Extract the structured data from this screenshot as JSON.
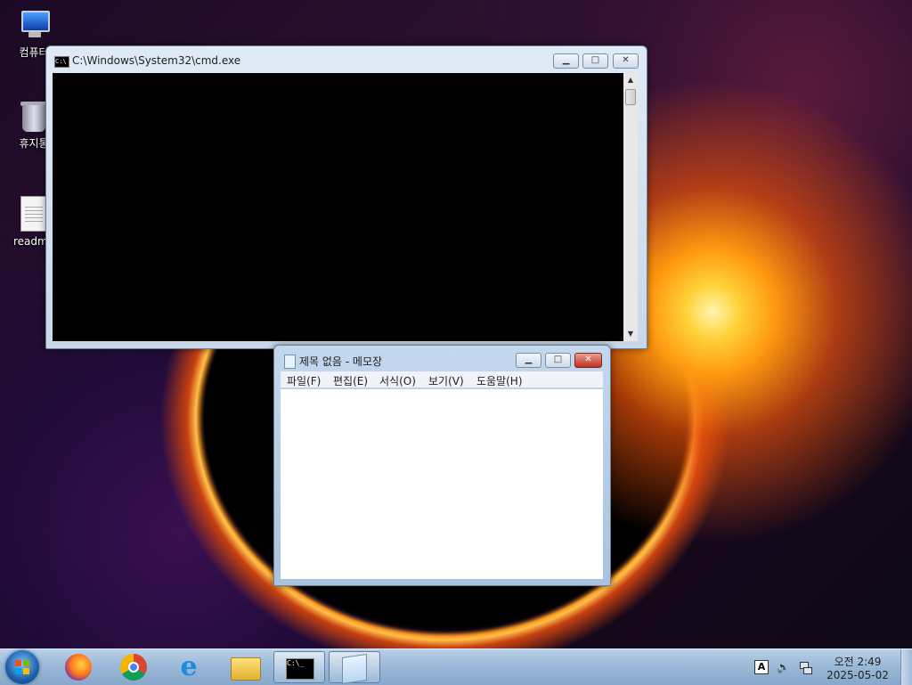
{
  "desktop": {
    "icons": [
      {
        "label": "컴퓨터",
        "icon": "computer-icon"
      },
      {
        "label": "휴지통",
        "icon": "recycle-bin-icon"
      },
      {
        "label": "readme",
        "icon": "text-file-icon"
      }
    ]
  },
  "cmd_window": {
    "title": "C:\\Windows\\System32\\cmd.exe",
    "icon": "cmd-icon",
    "minimize_label": "▁",
    "maximize_label": "□",
    "close_label": "✕"
  },
  "notepad_window": {
    "title": "제목 없음 - 메모장",
    "icon": "notepad-icon",
    "menu": [
      "파일(F)",
      "편집(E)",
      "서식(O)",
      "보기(V)",
      "도움말(H)"
    ],
    "minimize_label": "▁",
    "maximize_label": "□",
    "close_label": "✕",
    "content": ""
  },
  "taskbar": {
    "start_icon": "windows-start-icon",
    "pinned": [
      "firefox-icon",
      "chrome-icon",
      "internet-explorer-icon",
      "file-explorer-icon"
    ],
    "running": [
      "cmd-icon",
      "notepad-icon"
    ],
    "tray": {
      "ime_label": "A",
      "volume_icon": "volume-icon",
      "network_icon": "network-icon",
      "time": "오전 2:49",
      "date": "2025-05-02"
    }
  }
}
